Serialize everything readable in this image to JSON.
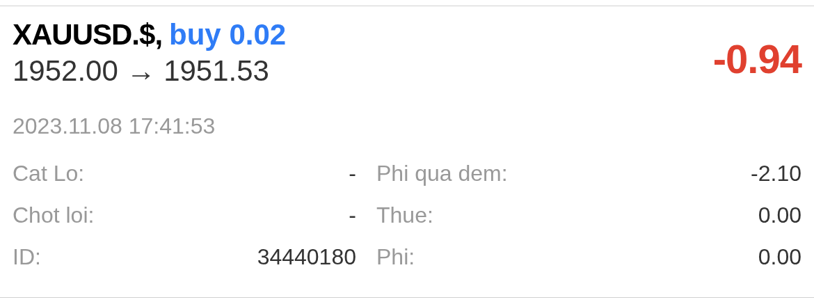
{
  "trade": {
    "symbol": "XAUUSD.$,",
    "order": "buy 0.02",
    "prices": "1952.00 → 1951.53",
    "profit": "-0.94",
    "time": "2023.11.08 17:41:53"
  },
  "details_left": [
    {
      "label": "Cat Lo:",
      "value": "-"
    },
    {
      "label": "Chot loi:",
      "value": "-"
    },
    {
      "label": "ID:",
      "value": "34440180"
    }
  ],
  "details_right": [
    {
      "label": "Phi qua dem:",
      "value": "-2.10"
    },
    {
      "label": "Thue:",
      "value": "0.00"
    },
    {
      "label": "Phi:",
      "value": "0.00"
    }
  ]
}
